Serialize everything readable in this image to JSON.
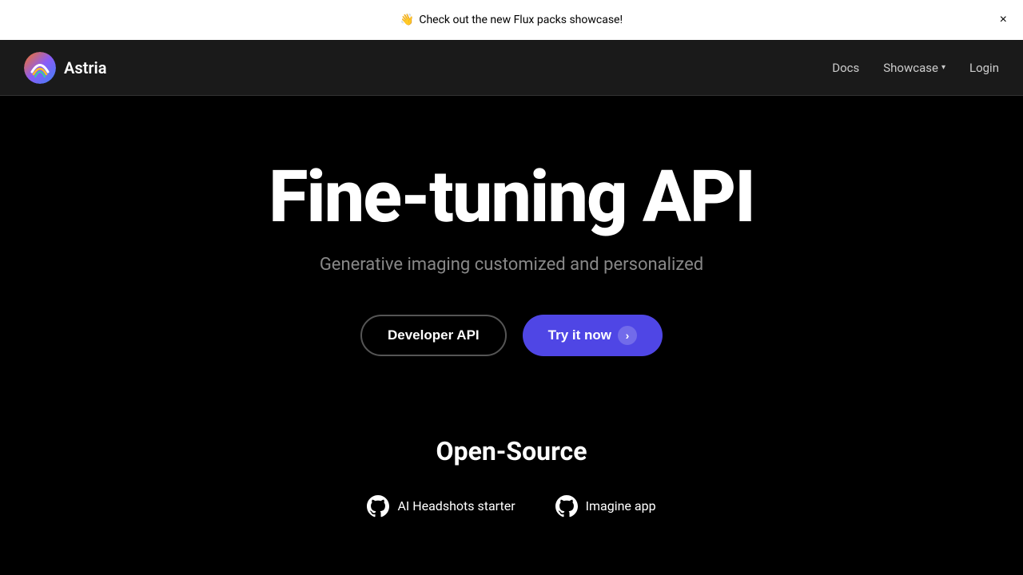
{
  "announcement": {
    "emoji": "👋",
    "text": "Check out the new Flux packs showcase!",
    "close_label": "×"
  },
  "navbar": {
    "brand": "Astria",
    "docs_label": "Docs",
    "showcase_label": "Showcase",
    "login_label": "Login"
  },
  "hero": {
    "title": "Fine-tuning API",
    "subtitle": "Generative imaging customized and personalized",
    "developer_button": "Developer API",
    "try_button": "Try it now",
    "try_arrow": "›"
  },
  "open_source": {
    "title": "Open-Source",
    "links": [
      {
        "label": "AI Headshots starter"
      },
      {
        "label": "Imagine app"
      }
    ]
  }
}
